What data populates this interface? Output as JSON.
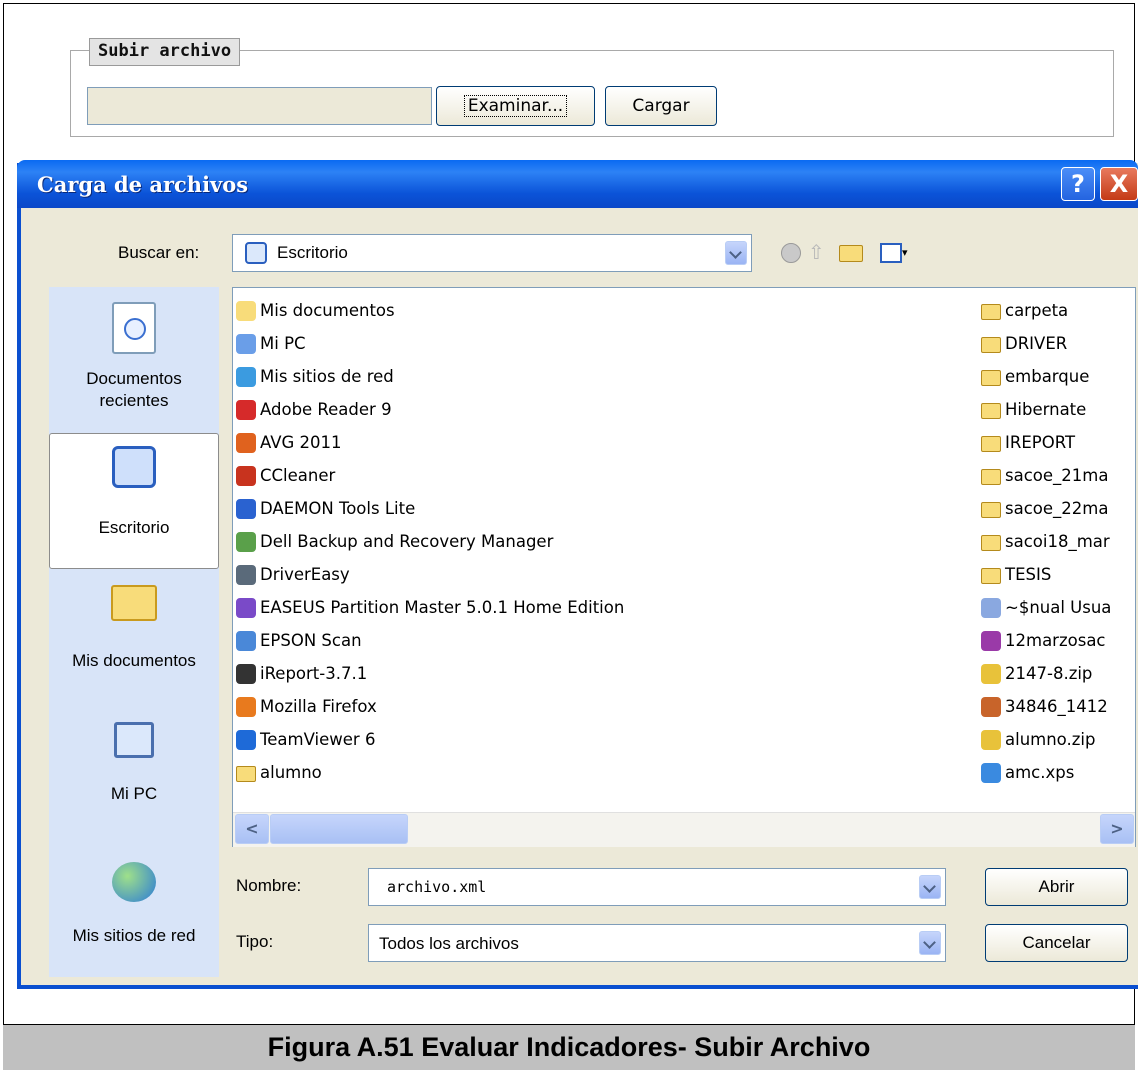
{
  "upload": {
    "legend": "Subir archivo",
    "browse_label": "Examinar...",
    "load_label": "Cargar"
  },
  "dialog": {
    "title": "Carga de archivos",
    "help_label": "?",
    "close_label": "X",
    "lookin_label": "Buscar en:",
    "lookin_value": "Escritorio",
    "places": [
      {
        "label": "Documentos recientes",
        "icon": "recent-documents-icon"
      },
      {
        "label": "Escritorio",
        "icon": "desktop-icon"
      },
      {
        "label": "Mis documentos",
        "icon": "my-documents-icon"
      },
      {
        "label": "Mi PC",
        "icon": "my-computer-icon"
      },
      {
        "label": "Mis sitios de red",
        "icon": "network-places-icon"
      }
    ],
    "files_left": [
      {
        "name": "Mis documentos",
        "icon": "my-documents-icon"
      },
      {
        "name": "Mi PC",
        "icon": "my-computer-icon"
      },
      {
        "name": "Mis sitios de red",
        "icon": "network-places-icon"
      },
      {
        "name": "Adobe Reader 9",
        "icon": "adobe-reader-icon"
      },
      {
        "name": "AVG 2011",
        "icon": "avg-icon"
      },
      {
        "name": "CCleaner",
        "icon": "ccleaner-icon"
      },
      {
        "name": "DAEMON Tools Lite",
        "icon": "daemon-tools-icon"
      },
      {
        "name": "Dell Backup and Recovery Manager",
        "icon": "dell-backup-icon"
      },
      {
        "name": "DriverEasy",
        "icon": "drivereasy-icon"
      },
      {
        "name": "EASEUS Partition Master 5.0.1 Home Edition",
        "icon": "easeus-icon"
      },
      {
        "name": "EPSON Scan",
        "icon": "epson-scan-icon"
      },
      {
        "name": "iReport-3.7.1",
        "icon": "ireport-icon"
      },
      {
        "name": "Mozilla Firefox",
        "icon": "firefox-icon"
      },
      {
        "name": "TeamViewer 6",
        "icon": "teamviewer-icon"
      },
      {
        "name": "alumno",
        "icon": "folder-icon"
      }
    ],
    "files_right": [
      {
        "name": "carpeta",
        "icon": "folder-icon"
      },
      {
        "name": "DRIVER",
        "icon": "folder-icon"
      },
      {
        "name": "embarque",
        "icon": "folder-icon"
      },
      {
        "name": "Hibernate",
        "icon": "folder-icon"
      },
      {
        "name": "IREPORT",
        "icon": "folder-icon"
      },
      {
        "name": "sacoe_21ma",
        "icon": "folder-icon"
      },
      {
        "name": "sacoe_22ma",
        "icon": "folder-icon"
      },
      {
        "name": "sacoi18_mar",
        "icon": "folder-icon"
      },
      {
        "name": "TESIS",
        "icon": "folder-icon"
      },
      {
        "name": "~$nual Usua",
        "icon": "word-document-icon"
      },
      {
        "name": "12marzosac",
        "icon": "winrar-icon"
      },
      {
        "name": "2147-8.zip",
        "icon": "zip-icon"
      },
      {
        "name": "34846_1412",
        "icon": "image-file-icon"
      },
      {
        "name": "alumno.zip",
        "icon": "zip-icon"
      },
      {
        "name": "amc.xps",
        "icon": "xps-icon"
      }
    ],
    "filename_label": "Nombre:",
    "filename_value": "archivo.xml",
    "filetype_label": "Tipo:",
    "filetype_value": "Todos los archivos",
    "open_label": "Abrir",
    "cancel_label": "Cancelar"
  },
  "caption": "Figura A.51 Evaluar Indicadores- Subir Archivo"
}
